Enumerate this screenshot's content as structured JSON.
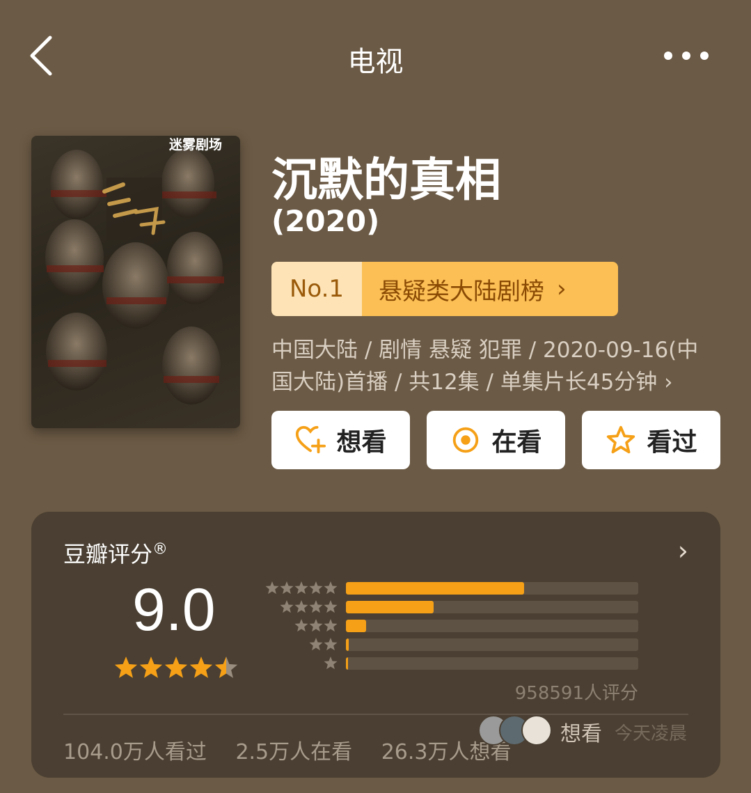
{
  "header": {
    "title": "电视"
  },
  "poster": {
    "brand": "迷雾剧场",
    "alt": "沉默的真相 poster"
  },
  "show": {
    "title": "沉默的真相",
    "year": "(2020)"
  },
  "ranking": {
    "rank": "No.1",
    "list_name": "悬疑类大陆剧榜",
    "arrow": "›"
  },
  "meta": {
    "text": "中国大陆 / 剧情 悬疑 犯罪 / 2020-09-16(中国大陆)首播 / 共12集 / 单集片长45分钟",
    "arrow": "›"
  },
  "actions": {
    "want": {
      "label": "想看",
      "icon": "heart-plus-icon"
    },
    "watching": {
      "label": "在看",
      "icon": "target-icon"
    },
    "watched": {
      "label": "看过",
      "icon": "star-outline-icon"
    }
  },
  "rating": {
    "title": "豆瓣评分",
    "registered": "®",
    "score": "9.0",
    "star_value": 4.5,
    "distribution": [
      {
        "stars": 5,
        "fraction": 0.61
      },
      {
        "stars": 4,
        "fraction": 0.3
      },
      {
        "stars": 3,
        "fraction": 0.07
      },
      {
        "stars": 2,
        "fraction": 0.01
      },
      {
        "stars": 1,
        "fraction": 0.003
      }
    ],
    "count_text": "958591人评分",
    "accent_color": "#f5a017"
  },
  "stats": {
    "watched": "104.0万人看过",
    "watching": "2.5万人在看",
    "want": "26.3万人想看"
  },
  "friend_activity": {
    "action": "想看",
    "time": "今天凌晨"
  }
}
